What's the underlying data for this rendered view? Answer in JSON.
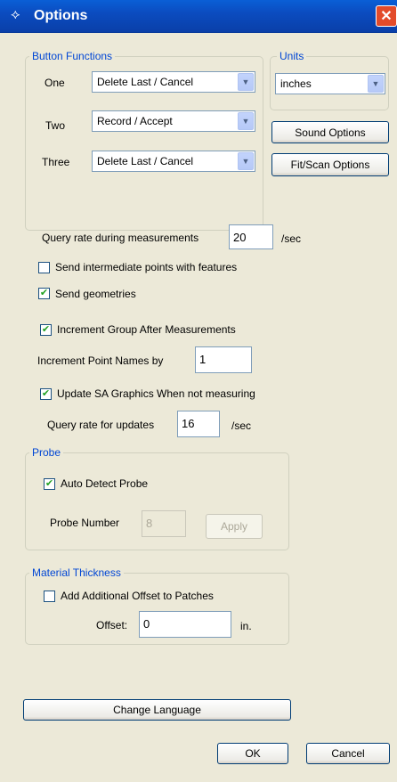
{
  "window": {
    "title": "Options"
  },
  "button_functions": {
    "legend": "Button Functions",
    "rows": [
      {
        "label": "One",
        "value": "Delete Last / Cancel"
      },
      {
        "label": "Two",
        "value": "Record / Accept"
      },
      {
        "label": "Three",
        "value": "Delete Last / Cancel"
      }
    ]
  },
  "units": {
    "legend": "Units",
    "value": "inches"
  },
  "buttons": {
    "sound_options": "Sound Options",
    "fit_scan_options": "Fit/Scan Options",
    "change_language": "Change Language",
    "ok": "OK",
    "cancel": "Cancel"
  },
  "query_rate": {
    "label": "Query rate during measurements",
    "value": "20",
    "unit": "/sec"
  },
  "checkboxes": {
    "send_intermediate": {
      "label": "Send intermediate points with features",
      "checked": false
    },
    "send_geometries": {
      "label": "Send geometries",
      "checked": true
    },
    "increment_group": {
      "label": "Increment Group After Measurements",
      "checked": true
    },
    "update_graphics": {
      "label": "Update SA Graphics When not measuring",
      "checked": true
    }
  },
  "increment_point": {
    "label": "Increment Point Names by",
    "value": "1"
  },
  "update_rate": {
    "label": "Query rate for updates",
    "value": "16",
    "unit": "/sec"
  },
  "probe": {
    "legend": "Probe",
    "auto_detect": {
      "label": "Auto Detect Probe",
      "checked": true
    },
    "number_label": "Probe Number",
    "number_value": "8",
    "apply": "Apply"
  },
  "material": {
    "legend": "Material Thickness",
    "add_offset": {
      "label": "Add Additional Offset to Patches",
      "checked": false
    },
    "offset_label": "Offset:",
    "offset_value": "0",
    "offset_unit": "in."
  }
}
